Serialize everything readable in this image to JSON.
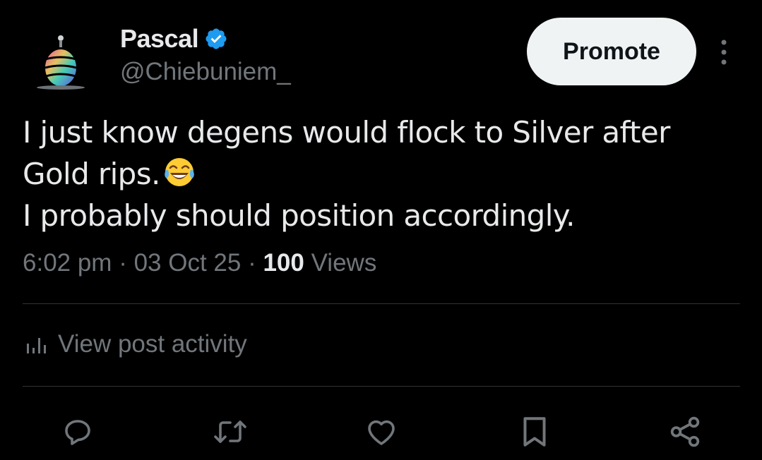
{
  "author": {
    "display_name": "Pascal",
    "handle": "@Chiebuniem_",
    "verified": true
  },
  "header": {
    "promote_label": "Promote"
  },
  "tweet": {
    "line1": "I just know degens would flock to Silver after",
    "line2": "Gold rips.",
    "line3": "I probably should position accordingly.",
    "emoji": "face-with-tears-of-joy"
  },
  "meta": {
    "time": "6:02 pm",
    "sep1": " · ",
    "date": "03 Oct 25",
    "sep2": " · ",
    "views_count": "100",
    "views_label": " Views"
  },
  "activity": {
    "label": "View post activity"
  },
  "icons": {
    "reply": "reply-icon",
    "repost": "repost-icon",
    "like": "heart-icon",
    "bookmark": "bookmark-icon",
    "share": "share-icon"
  },
  "colors": {
    "background": "#000000",
    "text_primary": "#e7e9ea",
    "text_secondary": "#71767b",
    "verified_blue": "#1d9bf0",
    "button_bg": "#eff3f4",
    "divider": "#2f3336"
  }
}
